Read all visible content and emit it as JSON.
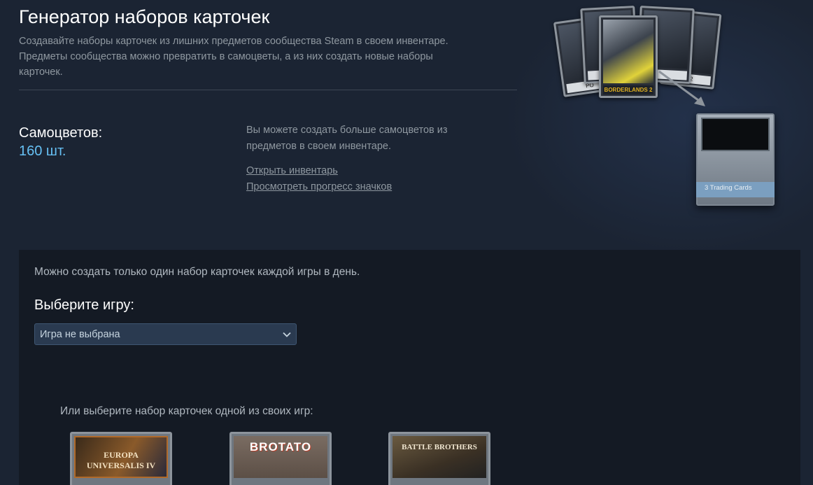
{
  "header": {
    "title": "Генератор наборов карточек",
    "desc_line1": "Создавайте наборы карточек из лишних предметов сообщества Steam в своем инвентаре.",
    "desc_line2": "Предметы сообщества можно превратить в самоцветы, а из них создать новые наборы",
    "desc_line3": "карточек."
  },
  "gems": {
    "label": "Самоцветов:",
    "count": "160 шт."
  },
  "info": {
    "line1": "Вы можете создать больше самоцветов из",
    "line2": "предметов в своем инвентаре.",
    "link_inventory": "Открыть инвентарь",
    "link_badges": "Просмотреть прогресс значков"
  },
  "illustration": {
    "card_left_cap": "PO",
    "card_main_cap": "BORDERLANDS 2",
    "card_right_cap": "TA 2",
    "pack_label": "3 Trading Cards"
  },
  "panel": {
    "limit_note": "Можно создать только один набор карточек каждой игры в день.",
    "choose_title": "Выберите игру:",
    "select_value": "Игра не выбрана",
    "or_text": "Или выберите набор карточек одной из своих игр:",
    "games": [
      {
        "logo": "EUROPA UNIVERSALIS IV"
      },
      {
        "logo": "BROTATO"
      },
      {
        "logo": "BATTLE BROTHERS"
      }
    ]
  },
  "colors": {
    "background": "#1b2433",
    "panel": "#141a24",
    "accent_blue": "#66c0f4",
    "select_bg": "#2a3a50"
  }
}
